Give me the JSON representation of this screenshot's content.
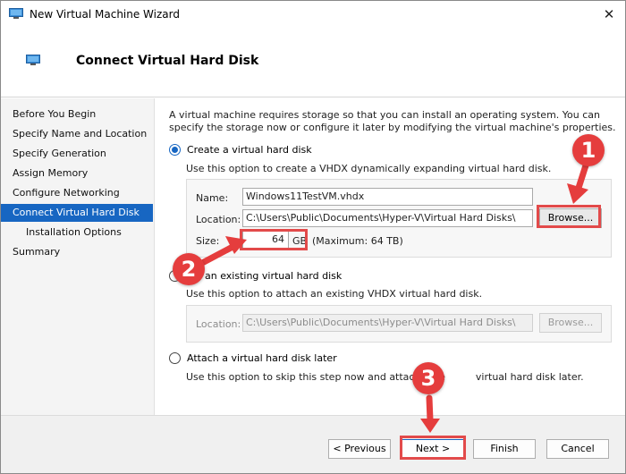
{
  "window": {
    "title": "New Virtual Machine Wizard",
    "close_glyph": "✕"
  },
  "header": {
    "title": "Connect Virtual Hard Disk"
  },
  "sidebar": {
    "items": [
      {
        "label": "Before You Begin"
      },
      {
        "label": "Specify Name and Location"
      },
      {
        "label": "Specify Generation"
      },
      {
        "label": "Assign Memory"
      },
      {
        "label": "Configure Networking"
      },
      {
        "label": "Connect Virtual Hard Disk"
      },
      {
        "label": "Installation Options"
      },
      {
        "label": "Summary"
      }
    ]
  },
  "main": {
    "intro": "A virtual machine requires storage so that you can install an operating system. You can specify the storage now or configure it later by modifying the virtual machine's properties.",
    "options": {
      "create": {
        "label": "Create a virtual hard disk",
        "desc": "Use this option to create a VHDX dynamically expanding virtual hard disk.",
        "name_label": "Name:",
        "name_value": "Windows11TestVM.vhdx",
        "location_label": "Location:",
        "location_value": "C:\\Users\\Public\\Documents\\Hyper-V\\Virtual Hard Disks\\",
        "browse_label": "Browse...",
        "size_label": "Size:",
        "size_value": "64",
        "size_unit": "GB",
        "size_max": "(Maximum: 64 TB)"
      },
      "existing": {
        "label": "an existing virtual hard disk",
        "desc": "Use this option to attach an existing VHDX virtual hard disk.",
        "location_label": "Location:",
        "location_value": "C:\\Users\\Public\\Documents\\Hyper-V\\Virtual Hard Disks\\",
        "browse_label": "Browse..."
      },
      "later": {
        "label": "Attach a virtual hard disk later",
        "desc": "Use this option to skip this step now and attach an e",
        "desc_tail": "virtual hard disk later."
      }
    }
  },
  "footer": {
    "previous_label": "< Previous",
    "next_label": "Next >",
    "finish_label": "Finish",
    "cancel_label": "Cancel"
  },
  "annotations": {
    "marker1": "1",
    "marker2": "2",
    "marker3": "3",
    "highlight_color": "#e24a4a",
    "marker_color": "#e53d3d"
  },
  "colors": {
    "accent": "#1766c2",
    "sidebar_bg": "#f4f4f4"
  }
}
